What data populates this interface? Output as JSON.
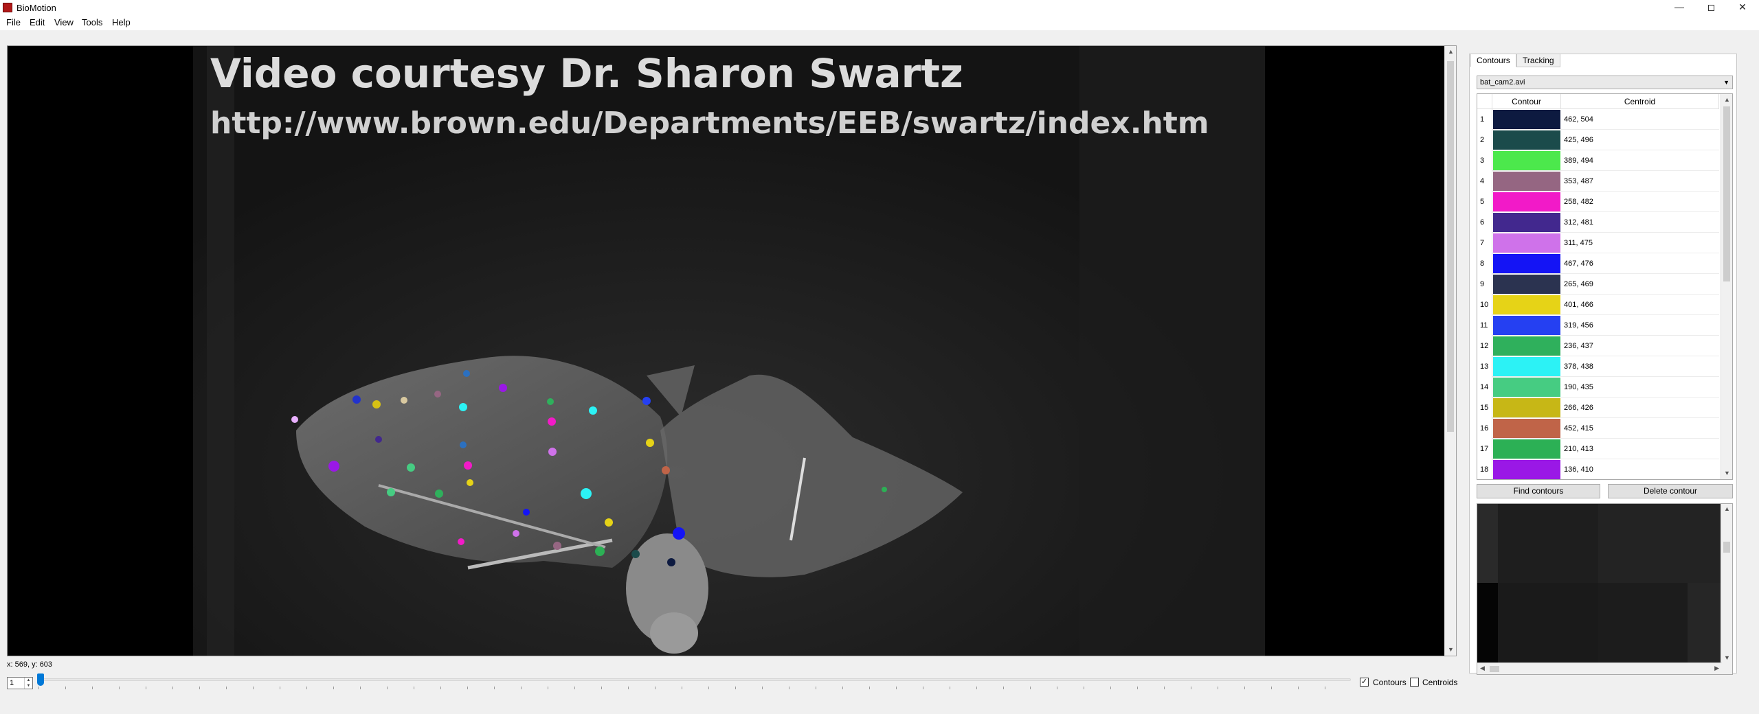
{
  "window": {
    "title": "BioMotion",
    "minimize_glyph": "—",
    "close_glyph": "✕"
  },
  "menu": [
    "File",
    "Edit",
    "View",
    "Tools",
    "Help"
  ],
  "video": {
    "overlay_line1": "Video courtesy Dr. Sharon Swartz",
    "overlay_line2": "http://www.brown.edu/Departments/EEB/swartz/index.htm"
  },
  "status": {
    "coords": "x: 569, y: 603"
  },
  "playback": {
    "frame": "1",
    "contours_label": "Contours",
    "contours_checked": true,
    "centroids_label": "Centroids",
    "centroids_checked": false
  },
  "panel": {
    "tabs": [
      "Contours",
      "Tracking"
    ],
    "active_tab": "Contours",
    "file_select": "bat_cam2.avi",
    "table": {
      "headers": [
        "Contour",
        "Centroid"
      ],
      "rows": [
        {
          "n": "1",
          "color": "#0d1a40",
          "centroid": "462, 504"
        },
        {
          "n": "2",
          "color": "#1b4b4b",
          "centroid": "425, 496"
        },
        {
          "n": "3",
          "color": "#4ce84c",
          "centroid": "389, 494"
        },
        {
          "n": "4",
          "color": "#956682",
          "centroid": "353, 487"
        },
        {
          "n": "5",
          "color": "#f21ac8",
          "centroid": "258, 482"
        },
        {
          "n": "6",
          "color": "#42288e",
          "centroid": "312, 481"
        },
        {
          "n": "7",
          "color": "#cf72ea",
          "centroid": "311, 475"
        },
        {
          "n": "8",
          "color": "#1414f5",
          "centroid": "467, 476"
        },
        {
          "n": "9",
          "color": "#2b3350",
          "centroid": "265, 469"
        },
        {
          "n": "10",
          "color": "#e6d317",
          "centroid": "401, 466"
        },
        {
          "n": "11",
          "color": "#2540f2",
          "centroid": "319, 456"
        },
        {
          "n": "12",
          "color": "#2fb05c",
          "centroid": "236, 437"
        },
        {
          "n": "13",
          "color": "#2cf2f5",
          "centroid": "378, 438"
        },
        {
          "n": "14",
          "color": "#46cc82",
          "centroid": "190, 435"
        },
        {
          "n": "15",
          "color": "#c7b716",
          "centroid": "266, 426"
        },
        {
          "n": "16",
          "color": "#c06448",
          "centroid": "452, 415"
        },
        {
          "n": "17",
          "color": "#2cb055",
          "centroid": "210, 413"
        },
        {
          "n": "18",
          "color": "#9a18e6",
          "centroid": "136, 410"
        }
      ]
    },
    "find_button": "Find contours",
    "delete_button": "Delete contour"
  }
}
